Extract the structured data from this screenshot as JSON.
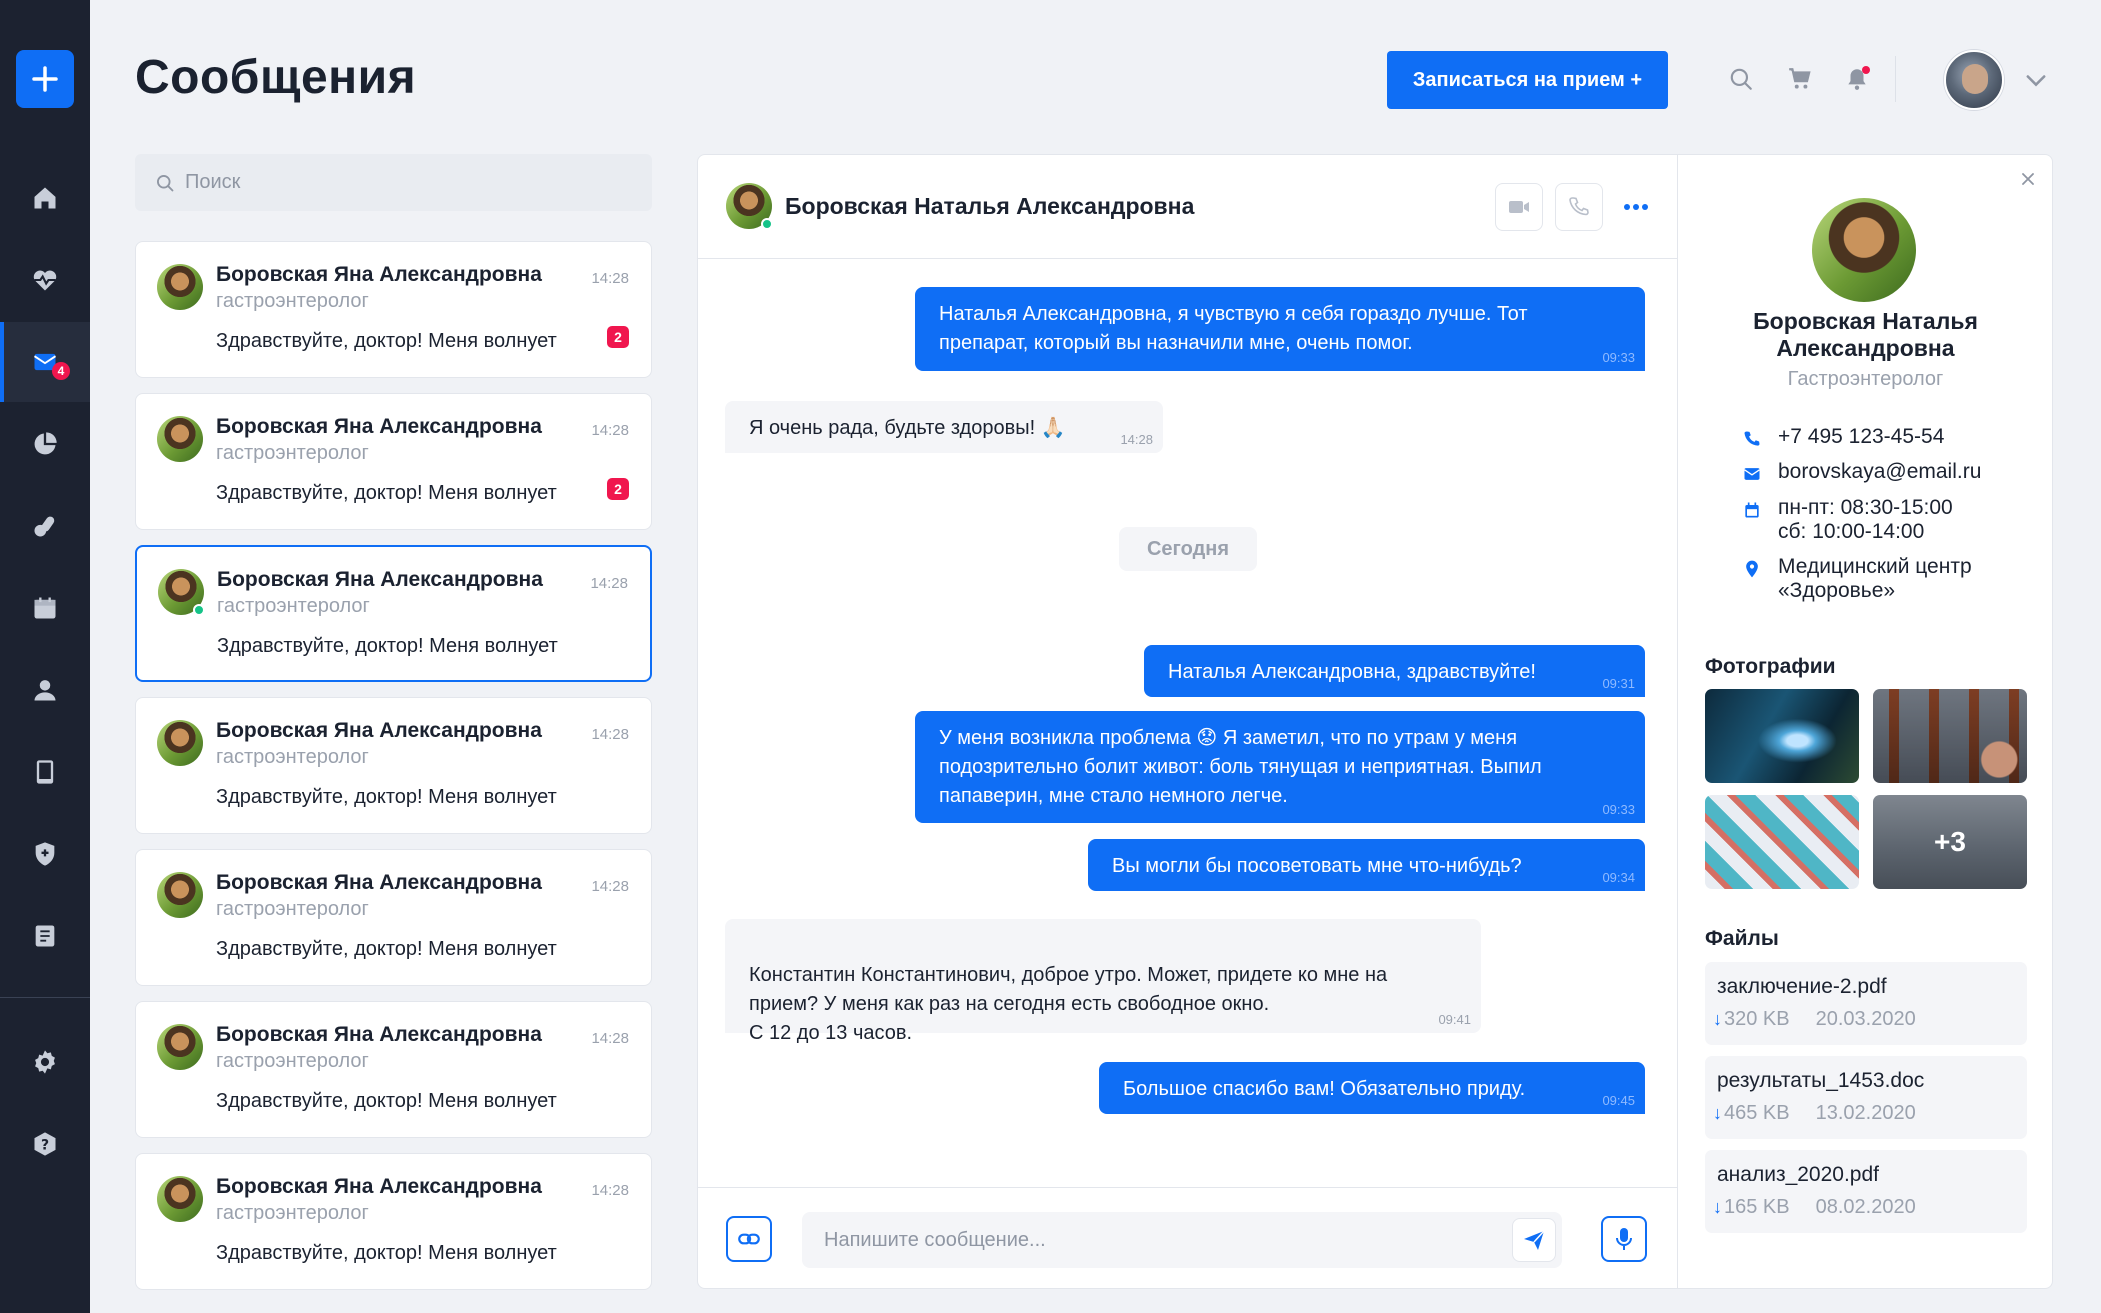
{
  "header": {
    "title": "Сообщения",
    "cta_label": "Записаться на прием +"
  },
  "sidebar": {
    "items": [
      {
        "name": "home-icon",
        "active": false
      },
      {
        "name": "heart-pulse-icon",
        "active": false
      },
      {
        "name": "mail-icon",
        "active": true,
        "badge": "4"
      },
      {
        "name": "pie-chart-icon",
        "active": false
      },
      {
        "name": "pills-icon",
        "active": false
      },
      {
        "name": "calendar-icon",
        "active": false
      },
      {
        "name": "user-icon",
        "active": false
      },
      {
        "name": "tablet-icon",
        "active": false
      },
      {
        "name": "shield-icon",
        "active": false
      },
      {
        "name": "book-icon",
        "active": false
      },
      {
        "name": "gear-icon",
        "active": false
      },
      {
        "name": "help-icon",
        "active": false
      }
    ]
  },
  "search": {
    "placeholder": "Поиск"
  },
  "conversations": [
    {
      "name": "Боровская Яна Александровна",
      "role": "гастроэнтеролог",
      "time": "14:28",
      "snippet": "Здравствуйте, доктор! Меня волнует",
      "badge": "2",
      "active": false,
      "online": false
    },
    {
      "name": "Боровская Яна Александровна",
      "role": "гастроэнтеролог",
      "time": "14:28",
      "snippet": "Здравствуйте, доктор! Меня волнует",
      "badge": "2",
      "active": false,
      "online": false
    },
    {
      "name": "Боровская Яна Александровна",
      "role": "гастроэнтеролог",
      "time": "14:28",
      "snippet": "Здравствуйте, доктор! Меня волнует",
      "badge": "",
      "active": true,
      "online": true
    },
    {
      "name": "Боровская Яна Александровна",
      "role": "гастроэнтеролог",
      "time": "14:28",
      "snippet": "Здравствуйте, доктор! Меня волнует",
      "badge": "",
      "active": false,
      "online": false
    },
    {
      "name": "Боровская Яна Александровна",
      "role": "гастроэнтеролог",
      "time": "14:28",
      "snippet": "Здравствуйте, доктор! Меня волнует",
      "badge": "",
      "active": false,
      "online": false
    },
    {
      "name": "Боровская Яна Александровна",
      "role": "гастроэнтеролог",
      "time": "14:28",
      "snippet": "Здравствуйте, доктор! Меня волнует",
      "badge": "",
      "active": false,
      "online": false
    },
    {
      "name": "Боровская Яна Александровна",
      "role": "гастроэнтеролог",
      "time": "14:28",
      "snippet": "Здравствуйте, доктор! Меня волнует",
      "badge": "",
      "active": false,
      "online": false
    }
  ],
  "chat": {
    "contact_name": "Боровская Наталья Александровна",
    "day_separator": "Сегодня",
    "messages": [
      {
        "dir": "out",
        "text": "Наталья Александровна, я чувствую я себя гораздо лучше. Тот препарат, который вы назначили мне, очень помог.",
        "time": "09:33"
      },
      {
        "dir": "in",
        "text": "Я очень рада, будьте здоровы! 🙏🏻",
        "time": "14:28"
      },
      {
        "dir": "out",
        "text": "Наталья Александровна, здравствуйте!",
        "time": "09:31"
      },
      {
        "dir": "out",
        "text": "У меня возникла проблема 😟 Я заметил, что по утрам у меня подозрительно болит живот: боль тянущая и неприятная. Выпил папаверин, мне стало немного легче.",
        "time": "09:33"
      },
      {
        "dir": "out",
        "text": "Вы могли бы посоветовать мне что-нибудь?",
        "time": "09:34"
      },
      {
        "dir": "in",
        "text": "Константин Константинович, доброе утро. Может, придете ко мне на прием? У меня как раз на сегодня есть свободное окно.\nС 12 до 13 часов.",
        "time": "09:41"
      },
      {
        "dir": "out",
        "text": "Большое спасибо вам! Обязательно приду.",
        "time": "09:45"
      }
    ],
    "composer_placeholder": "Напишите сообщение..."
  },
  "profile": {
    "name": "Боровская Наталья Александровна",
    "role": "Гастроэнтеролог",
    "phone": "+7 495 123-45-54",
    "email": "borovskaya@email.ru",
    "hours_weekdays": "пн-пт: 08:30-15:00",
    "hours_saturday": "сб: 10:00-14:00",
    "clinic": "Медицинский центр «Здоровье»",
    "photos_title": "Фотографии",
    "photos_more": "+3",
    "files_title": "Файлы",
    "files": [
      {
        "name": "заключение-2.pdf",
        "size": "320 KB",
        "date": "20.03.2020"
      },
      {
        "name": "результаты_1453.doc",
        "size": "465 KB",
        "date": "13.02.2020"
      },
      {
        "name": "анализ_2020.pdf",
        "size": "165 KB",
        "date": "08.02.2020"
      }
    ]
  },
  "colors": {
    "accent": "#0f6ef5",
    "sidebar_bg": "#1c2230",
    "badge": "#f0164e",
    "online": "#15c388"
  }
}
